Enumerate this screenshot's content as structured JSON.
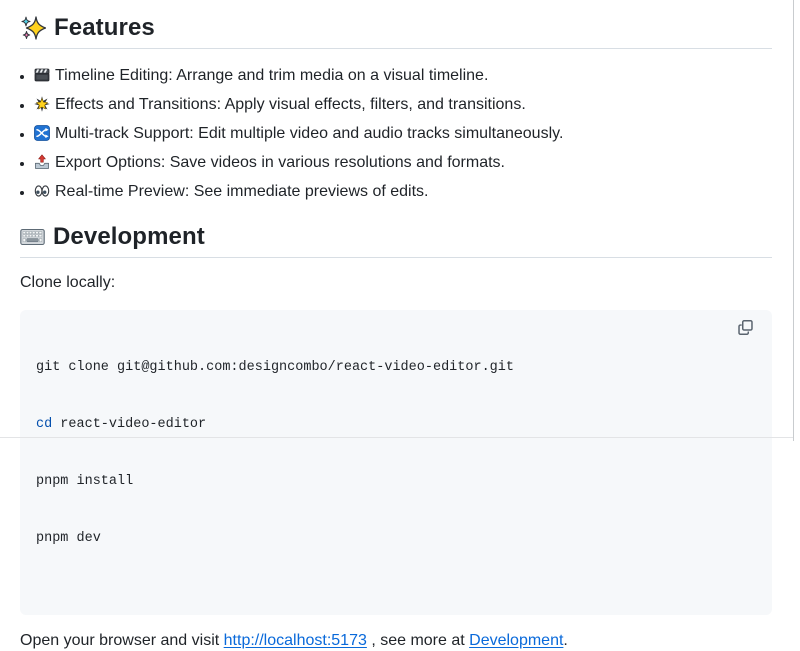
{
  "features": {
    "heading": "Features",
    "heading_icon": "sparkles-icon",
    "heading_emoji": "✨",
    "items": [
      {
        "icon": "clapper-board-icon",
        "emoji": "🎬",
        "text": "Timeline Editing: Arrange and trim media on a visual timeline."
      },
      {
        "icon": "glowing-star-icon",
        "emoji": "🌟",
        "text": "Effects and Transitions: Apply visual effects, filters, and transitions."
      },
      {
        "icon": "shuffle-tracks-icon",
        "emoji": "🔀",
        "text": "Multi-track Support: Edit multiple video and audio tracks simultaneously."
      },
      {
        "icon": "outbox-tray-icon",
        "emoji": "📤",
        "text": "Export Options: Save videos in various resolutions and formats."
      },
      {
        "icon": "eyes-icon",
        "emoji": "👀",
        "text": "Real-time Preview: See immediate previews of edits."
      }
    ]
  },
  "development": {
    "heading": "Development",
    "heading_icon": "keyboard-icon",
    "heading_emoji": "⌨️",
    "intro": "Clone locally:",
    "code": {
      "line1": "git clone git@github.com:designcombo/react-video-editor.git",
      "line2_keyword": "cd",
      "line2_rest": " react-video-editor",
      "line3": "pnpm install",
      "line4": "pnpm dev",
      "copy_icon": "copy-icon"
    },
    "outro": {
      "before_link1": "Open your browser and visit ",
      "link1": "http://localhost:5173",
      "between": " , see more at ",
      "link2": "Development",
      "after": "."
    }
  },
  "colors": {
    "text": "#1f2328",
    "link": "#0969da",
    "code_keyword": "#0550ae",
    "code_background": "#f6f8fa",
    "divider": "#d8dee4"
  }
}
